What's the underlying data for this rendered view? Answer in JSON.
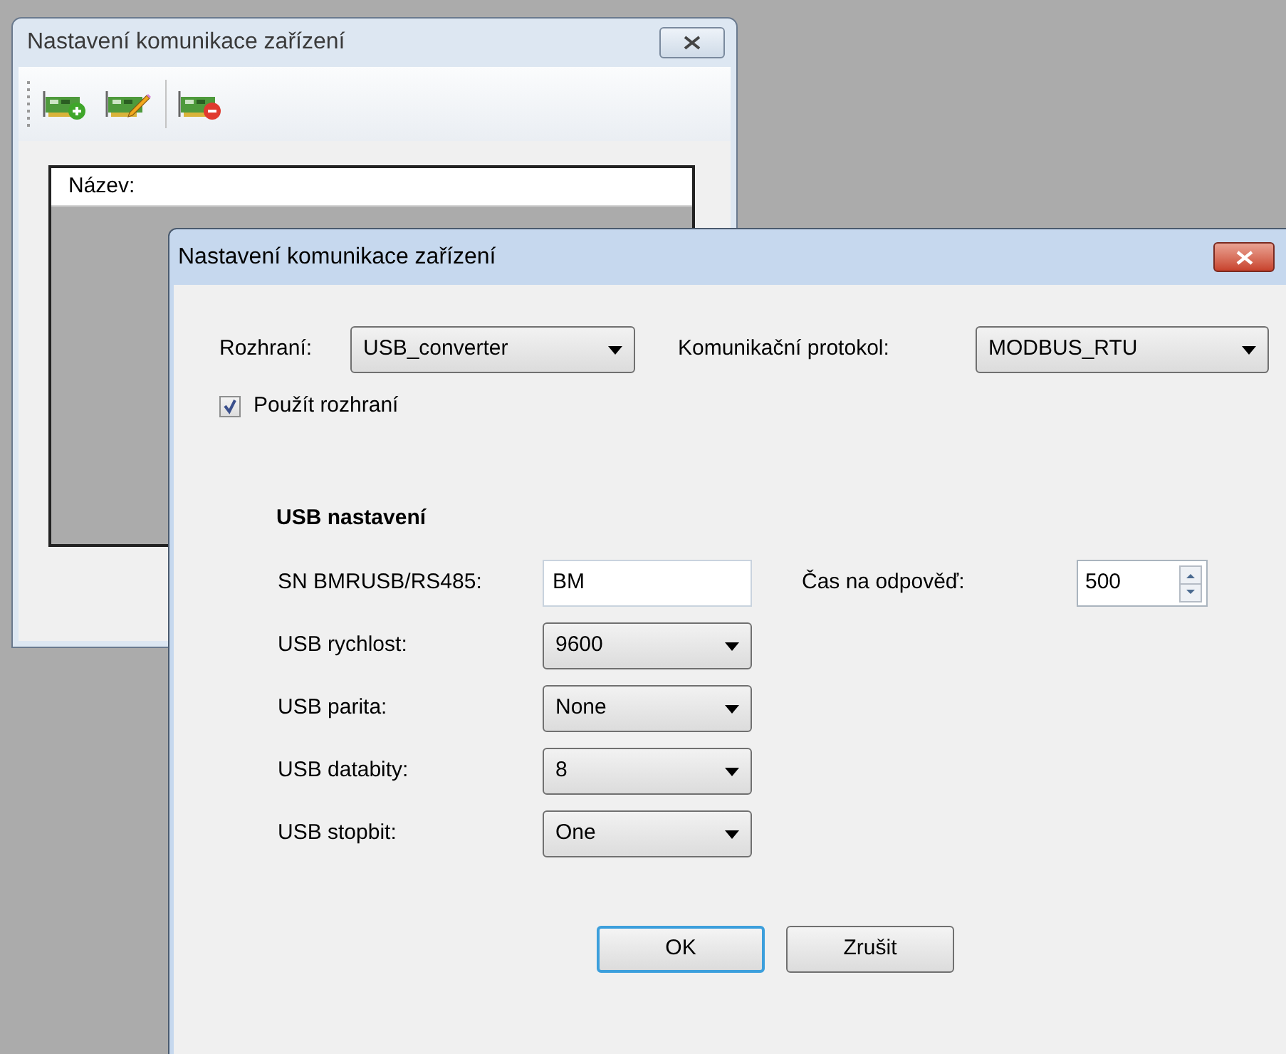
{
  "background_window": {
    "title": "Nastavení komunikace zařízení",
    "toolbar_buttons": [
      {
        "kind": "add"
      },
      {
        "kind": "edit"
      },
      {
        "kind": "remove"
      }
    ],
    "list": {
      "columns": [
        "Název:"
      ]
    }
  },
  "dialog": {
    "title": "Nastavení komunikace zařízení",
    "interface": {
      "label": "Rozhraní:",
      "value": "USB_converter"
    },
    "protocol": {
      "label": "Komunikační protokol:",
      "value": "MODBUS_RTU"
    },
    "use_interface": {
      "label": "Použít rozhraní",
      "checked": true
    },
    "section_title": "USB nastavení",
    "fields": [
      {
        "kind": "text",
        "label": "SN BMRUSB/RS485:",
        "value": "BM"
      },
      {
        "kind": "combo",
        "label": "USB rychlost:",
        "value": "9600"
      },
      {
        "kind": "combo",
        "label": "USB parita:",
        "value": "None"
      },
      {
        "kind": "combo",
        "label": "USB databity:",
        "value": "8"
      },
      {
        "kind": "combo",
        "label": "USB stopbit:",
        "value": "One"
      }
    ],
    "timeout": {
      "label": "Čas na odpověď:",
      "value": "500"
    },
    "buttons": [
      {
        "label": "OK",
        "default": true
      },
      {
        "label": "Zrušit",
        "default": false
      }
    ]
  }
}
